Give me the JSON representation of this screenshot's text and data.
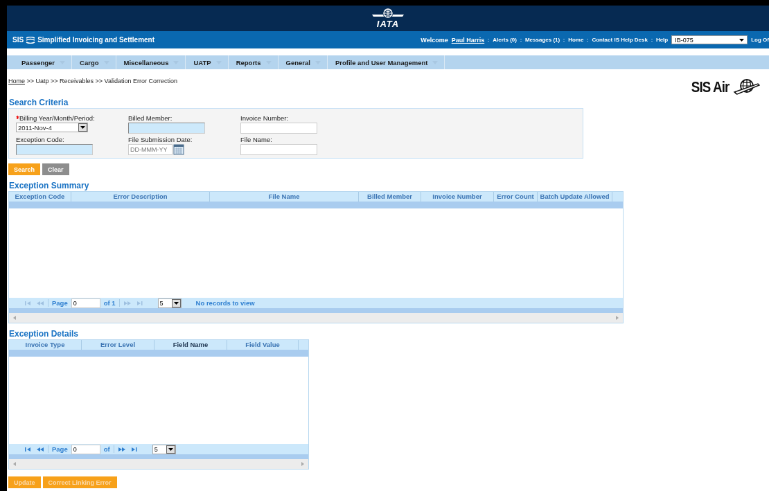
{
  "header": {
    "logo_text": "IATA"
  },
  "top_bar": {
    "app_prefix": "SIS",
    "app_name": "Simplified Invoicing and Settlement",
    "welcome": "Welcome",
    "user": "Paul Harris",
    "links": [
      "Alerts (0)",
      "Messages (1)",
      "Home",
      "Contact IS Help Desk",
      "Help"
    ],
    "member": "IB-075",
    "logout": "Log Of"
  },
  "menu": [
    {
      "label": "Passenger"
    },
    {
      "label": "Cargo"
    },
    {
      "label": "Miscellaneous"
    },
    {
      "label": "UATP"
    },
    {
      "label": "Reports"
    },
    {
      "label": "General"
    },
    {
      "label": "Profile and User Management"
    }
  ],
  "breadcrumb": {
    "link": "Home",
    "trail": ">> Uatp >> Receivables >> Validation Error Correction"
  },
  "brand_logo": "SIS Air",
  "search_criteria": {
    "title": "Search Criteria",
    "fields": [
      {
        "label": "Billing Year/Month/Period:",
        "required": true,
        "kind": "select",
        "value": "2011-Nov-4"
      },
      {
        "label": "Billed Member:",
        "required": false,
        "kind": "autocomplete"
      },
      {
        "label": "Invoice Number:",
        "required": false,
        "kind": "text"
      },
      {
        "label": "Exception Code:",
        "required": false,
        "kind": "autocomplete"
      },
      {
        "label": "File Submission Date:",
        "required": false,
        "kind": "date",
        "placeholder": "DD-MMM-YY"
      },
      {
        "label": "File Name:",
        "required": false,
        "kind": "text"
      }
    ],
    "buttons": [
      {
        "label": "Search",
        "kind": "primary"
      },
      {
        "label": "Clear",
        "kind": "secondary"
      }
    ]
  },
  "exception_summary": {
    "title": "Exception Summary",
    "columns": [
      {
        "label": "Exception Code",
        "sorted": false
      },
      {
        "label": "Error Description",
        "sorted": false
      },
      {
        "label": "File Name",
        "sorted": false
      },
      {
        "label": "Billed Member",
        "sorted": false
      },
      {
        "label": "Invoice Number",
        "sorted": false
      },
      {
        "label": "Error Count",
        "sorted": false
      },
      {
        "label": "Batch Update Allowed",
        "sorted": false
      }
    ],
    "pager": {
      "page_label": "Page",
      "page": "0",
      "of": "of 1",
      "page_size": "5",
      "status": "No records to view",
      "nav_disabled": true
    }
  },
  "exception_details": {
    "title": "Exception Details",
    "columns": [
      {
        "label": "Invoice Type",
        "sorted": false
      },
      {
        "label": "Error Level",
        "sorted": false
      },
      {
        "label": "Field Name",
        "sorted": true
      },
      {
        "label": "Field Value",
        "sorted": false
      }
    ],
    "pager": {
      "page_label": "Page",
      "page": "0",
      "of": "of",
      "page_size": "5",
      "nav_disabled": false
    }
  },
  "actions": [
    {
      "label": "Update",
      "disabled": true
    },
    {
      "label": "Correct Linking Error",
      "disabled": true
    }
  ]
}
